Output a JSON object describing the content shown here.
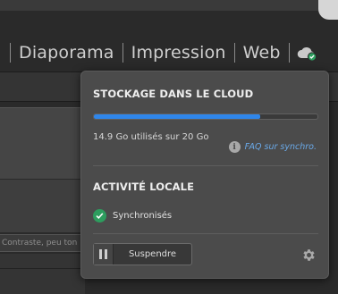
{
  "modules": [
    {
      "label": "Diaporama"
    },
    {
      "label": "Impression"
    },
    {
      "label": "Web"
    }
  ],
  "toolbar": {
    "cloud_icon": "cloud-sync-icon"
  },
  "background": {
    "input_text": "Contraste, peu ton"
  },
  "popup": {
    "storage_title": "STOCKAGE DANS LE CLOUD",
    "storage_used_fraction": 0.745,
    "usage_text": "14.9 Go utilisés sur 20 Go",
    "faq_label": "FAQ sur synchro.",
    "faq_icon": "info-icon",
    "activity_title": "ACTIVITÉ LOCALE",
    "sync_status": "Synchronisés",
    "sync_icon": "check-circle-icon",
    "pause_label": "Suspendre",
    "pause_icon": "pause-icon",
    "settings_icon": "gear-icon"
  },
  "colors": {
    "accent": "#2f86ea",
    "success": "#2d9d5e",
    "link": "#6aa9e8"
  }
}
